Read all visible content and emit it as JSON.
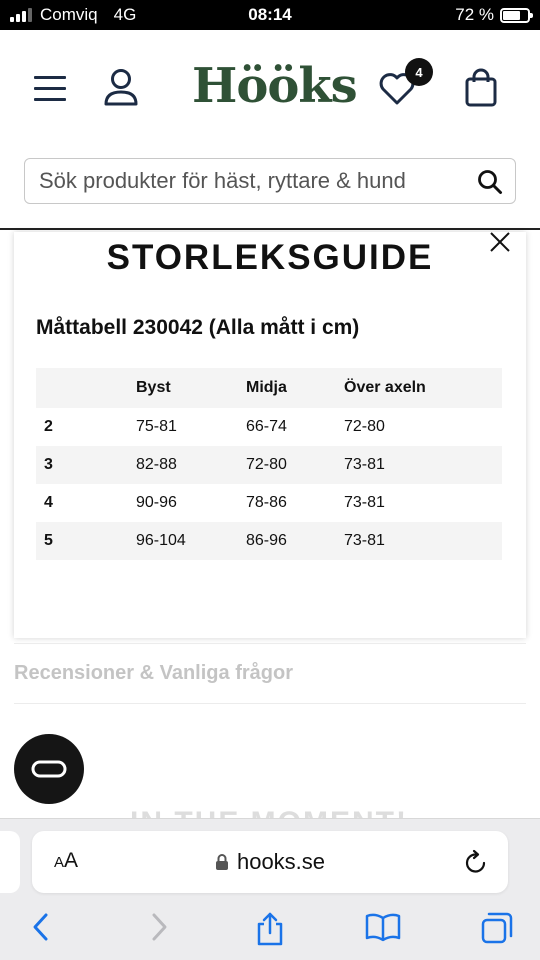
{
  "status_bar": {
    "carrier": "Comviq",
    "network": "4G",
    "time": "08:14",
    "battery_label": "72 %",
    "battery_level": 0.72
  },
  "header": {
    "logo": "Hööks",
    "wishlist_count": "4",
    "search_placeholder": "Sök produkter för häst, ryttare & hund"
  },
  "size_guide": {
    "title": "STORLEKSGUIDE",
    "caption": "Måttabell 230042 (Alla mått i cm)",
    "columns": [
      "",
      "Byst",
      "Midja",
      "Över axeln"
    ],
    "rows": [
      [
        "2",
        "75-81",
        "66-74",
        "72-80"
      ],
      [
        "3",
        "82-88",
        "72-80",
        "73-81"
      ],
      [
        "4",
        "90-96",
        "78-86",
        "73-81"
      ],
      [
        "5",
        "96-104",
        "86-96",
        "73-81"
      ]
    ]
  },
  "page": {
    "reviews_heading": "Recensioner & Vanliga frågor",
    "moment_heading": "IN THE MOMENT!"
  },
  "browser": {
    "aa_label": "AA",
    "url": "hooks.se"
  },
  "colors": {
    "brand_green": "#2f5136",
    "nav_navy": "#1c2b44",
    "safari_blue": "#1a73e8"
  }
}
